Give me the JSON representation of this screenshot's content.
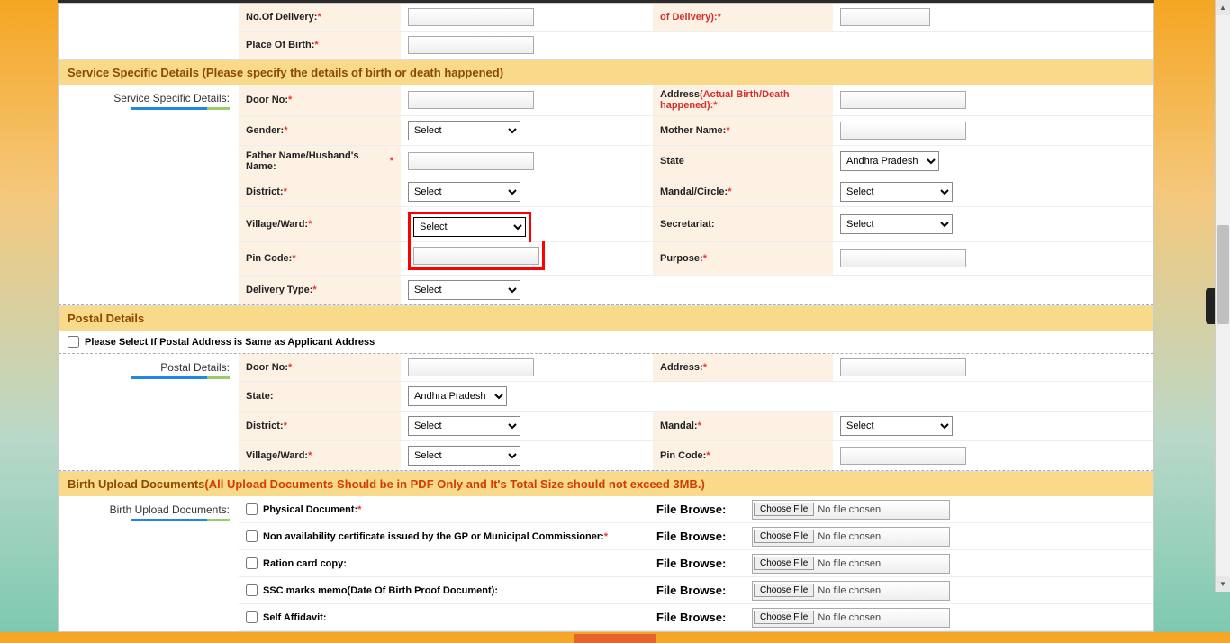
{
  "topRemnant": {
    "noOfDelivery": "No.Of Delivery:",
    "ofDelivery": "of Delivery):",
    "placeOfBirth": "Place Of Birth:"
  },
  "serviceSection": {
    "header": "Service Specific Details (Please specify the details of birth or death happened)",
    "sideLabel": "Service Specific Details:",
    "doorNo": "Door No:",
    "address": "Address",
    "addressNote": "(Actual Birth/Death happened):",
    "gender": "Gender:",
    "genderOptions": [
      "Select"
    ],
    "motherName": "Mother Name:",
    "fatherHusband": "Father Name/Husband's Name:",
    "state": "State",
    "stateOptions": [
      "Andhra Pradesh"
    ],
    "district": "District:",
    "districtOptions": [
      "Select"
    ],
    "mandalCircle": "Mandal/Circle:",
    "mandalOptions": [
      "Select"
    ],
    "villageWard": "Village/Ward:",
    "villageOptions": [
      "Select"
    ],
    "secretariat": "Secretariat:",
    "secretariatOptions": [
      "Select"
    ],
    "pinCode": "Pin Code:",
    "purpose": "Purpose:",
    "deliveryType": "Delivery Type:",
    "deliveryOptions": [
      "Select"
    ]
  },
  "postalSection": {
    "header": "Postal Details",
    "sameCheckbox": "Please Select If Postal Address is Same as Applicant Address",
    "sideLabel": "Postal Details:",
    "doorNo": "Door No:",
    "address": "Address:",
    "state": "State:",
    "stateOptions": [
      "Andhra Pradesh"
    ],
    "district": "District:",
    "districtOptions": [
      "Select"
    ],
    "mandal": "Mandal:",
    "mandalOptions": [
      "Select"
    ],
    "villageWard": "Village/Ward:",
    "villageOptions": [
      "Select"
    ],
    "pinCode": "Pin Code:"
  },
  "uploadSection": {
    "headerMain": "Birth Upload Documents",
    "headerWarn": "(All Upload Documents Should be in PDF Only and It's Total Size should not exceed 3MB.)",
    "sideLabel": "Birth Upload Documents:",
    "fileBrowse": "File Browse:",
    "chooseFile": "Choose File",
    "noFile": "No file chosen",
    "docs": [
      {
        "label": "Physical Document:",
        "required": true
      },
      {
        "label": "Non availability certificate issued by the GP or Municipal Commissioner:",
        "required": true
      },
      {
        "label": "Ration card copy:",
        "required": false
      },
      {
        "label": "SSC marks memo(Date Of Birth Proof Document):",
        "required": false
      },
      {
        "label": "Self Affidavit:",
        "required": false
      }
    ]
  }
}
